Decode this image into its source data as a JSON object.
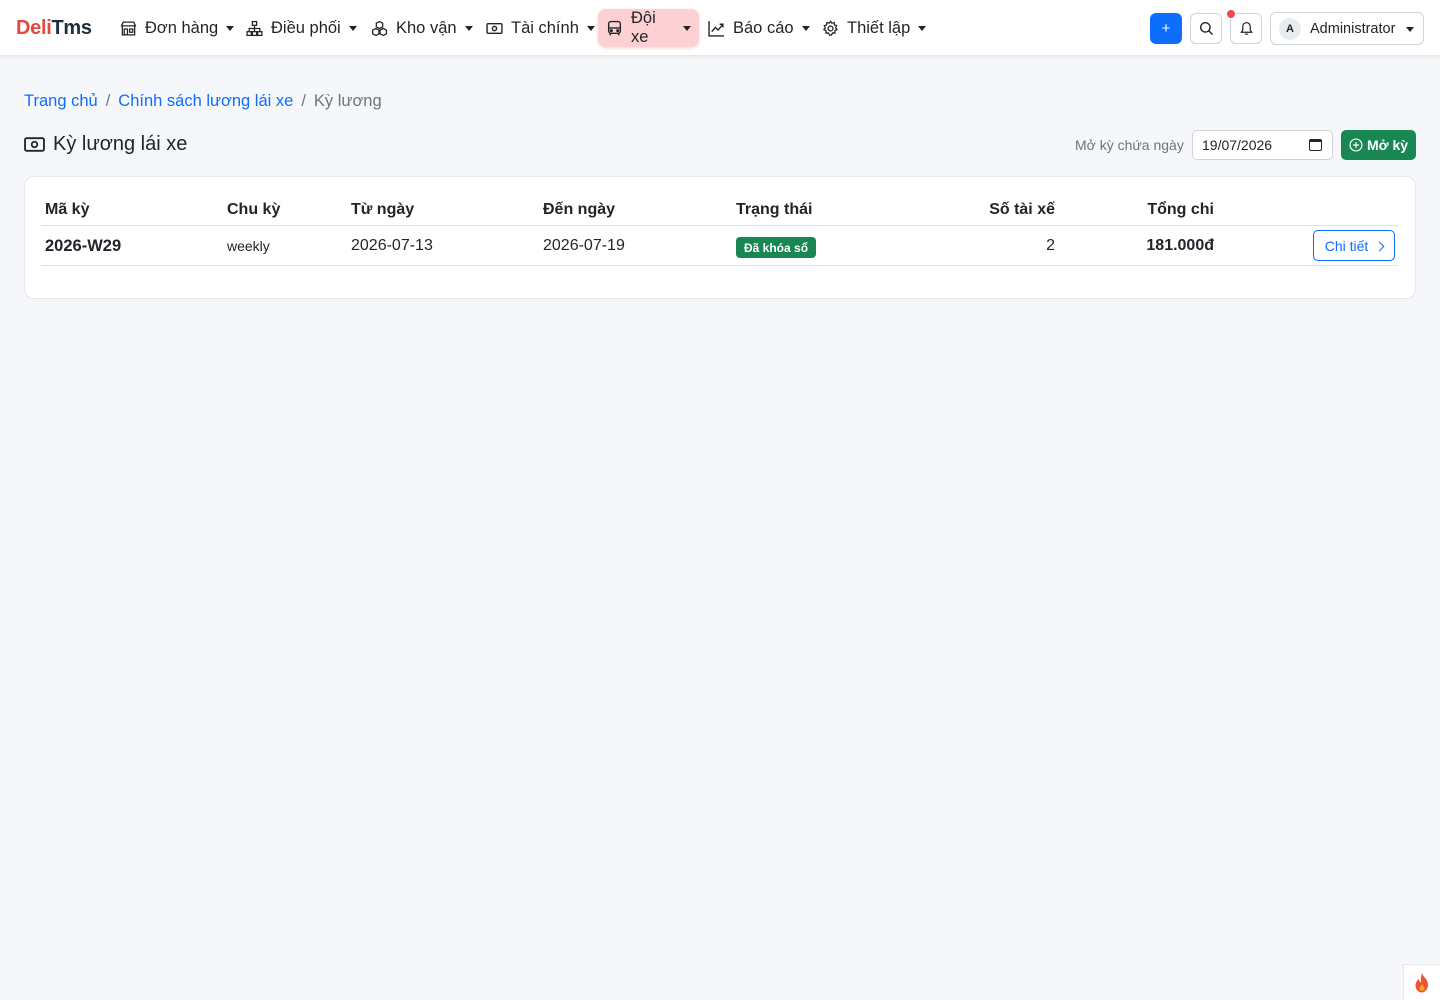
{
  "brand": {
    "part1": "Deli",
    "part2": "Tms"
  },
  "nav": {
    "items": [
      {
        "label": "Đơn hàng",
        "icon": "store-icon"
      },
      {
        "label": "Điều phối",
        "icon": "network-icon"
      },
      {
        "label": "Kho vận",
        "icon": "boxes-icon"
      },
      {
        "label": "Tài chính",
        "icon": "cash-icon"
      },
      {
        "label": "Đội xe",
        "icon": "bus-icon",
        "active": true
      },
      {
        "label": "Báo cáo",
        "icon": "chart-line-icon"
      },
      {
        "label": "Thiết lập",
        "icon": "gear-icon"
      }
    ],
    "plus_label": "+",
    "user": {
      "avatar_letter": "A",
      "name": "Administrator"
    }
  },
  "breadcrumb": {
    "home": "Trang chủ",
    "policy": "Chính sách lương lái xe",
    "current": "Kỳ lương",
    "separator": "/"
  },
  "page": {
    "title": "Kỳ lương lái xe",
    "open_label": "Mở kỳ chứa ngày",
    "open_date": "19/07/2026",
    "open_button": "Mở kỳ"
  },
  "table": {
    "headers": {
      "code": "Mã kỳ",
      "cycle": "Chu kỳ",
      "from": "Từ ngày",
      "to": "Đến ngày",
      "status": "Trạng thái",
      "drivers": "Số tài xế",
      "total": "Tổng chi"
    },
    "rows": [
      {
        "code": "2026-W29",
        "cycle": "weekly",
        "from": "2026-07-13",
        "to": "2026-07-19",
        "status": "Đã khóa sổ",
        "drivers": "2",
        "total": "181.000đ",
        "action": "Chi tiết"
      }
    ]
  },
  "colors": {
    "primary": "#0d6efd",
    "success": "#198754",
    "brand_red": "#e8473f",
    "active_nav_bg": "#fdd0d3"
  }
}
